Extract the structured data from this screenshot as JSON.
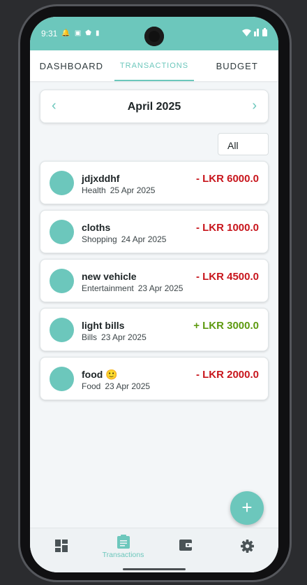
{
  "status": {
    "time": "9:31"
  },
  "tabs": [
    {
      "label": "DASHBOARD",
      "active": false
    },
    {
      "label": "TRANSACTIONS",
      "active": true
    },
    {
      "label": "BUDGET",
      "active": false
    }
  ],
  "month": {
    "title": "April 2025",
    "prev_icon": "chevron-left",
    "next_icon": "chevron-right"
  },
  "filter": {
    "value": "All"
  },
  "transactions": [
    {
      "name": "jdjxddhf",
      "category": "Health",
      "date": "25 Apr 2025",
      "amount": "- LKR 6000.0",
      "type": "expense"
    },
    {
      "name": "cloths",
      "category": "Shopping",
      "date": "24 Apr 2025",
      "amount": "- LKR 1000.0",
      "type": "expense"
    },
    {
      "name": "new vehicle",
      "category": "Entertainment",
      "date": "23 Apr 2025",
      "amount": "- LKR 4500.0",
      "type": "expense"
    },
    {
      "name": "light bills",
      "category": "Bills",
      "date": "23 Apr 2025",
      "amount": "+ LKR 3000.0",
      "type": "income"
    },
    {
      "name": "food 🙂",
      "category": "Food",
      "date": "23 Apr 2025",
      "amount": "- LKR 2000.0",
      "type": "expense"
    }
  ],
  "fab": {
    "icon": "plus-icon"
  },
  "bottom_nav": [
    {
      "icon": "dashboard-icon",
      "label": "",
      "active": false
    },
    {
      "icon": "clipboard-icon",
      "label": "Transactions",
      "active": true
    },
    {
      "icon": "wallet-icon",
      "label": "",
      "active": false
    },
    {
      "icon": "gear-icon",
      "label": "",
      "active": false
    }
  ],
  "colors": {
    "accent": "#6cc7bc",
    "expense": "#c8161d",
    "income": "#5e9a10"
  }
}
